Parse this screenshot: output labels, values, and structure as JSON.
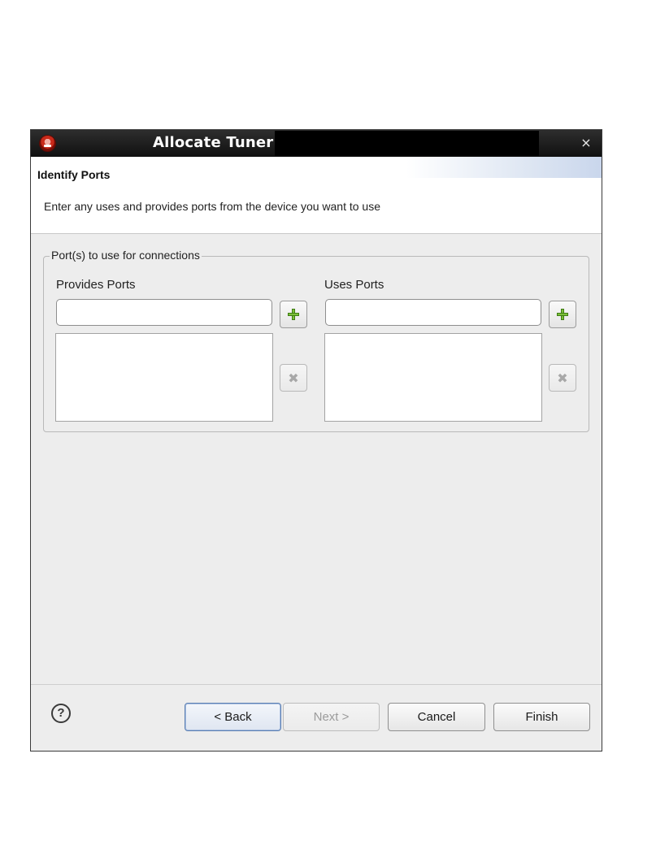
{
  "window": {
    "title": "Allocate Tuner",
    "close_symbol": "×"
  },
  "header": {
    "title": "Identify Ports",
    "description": "Enter any uses and provides ports from the device you want to use"
  },
  "group": {
    "legend": "Port(s) to use for connections",
    "provides": {
      "label": "Provides Ports",
      "input_value": "",
      "items": []
    },
    "uses": {
      "label": "Uses Ports",
      "input_value": "",
      "items": []
    }
  },
  "icons": {
    "add": "plus-icon",
    "remove": "remove-x-icon",
    "help": "help-icon",
    "app": "app-icon"
  },
  "footer": {
    "help_symbol": "?",
    "back_label": "< Back",
    "next_label": "Next >",
    "cancel_label": "Cancel",
    "finish_label": "Finish"
  }
}
